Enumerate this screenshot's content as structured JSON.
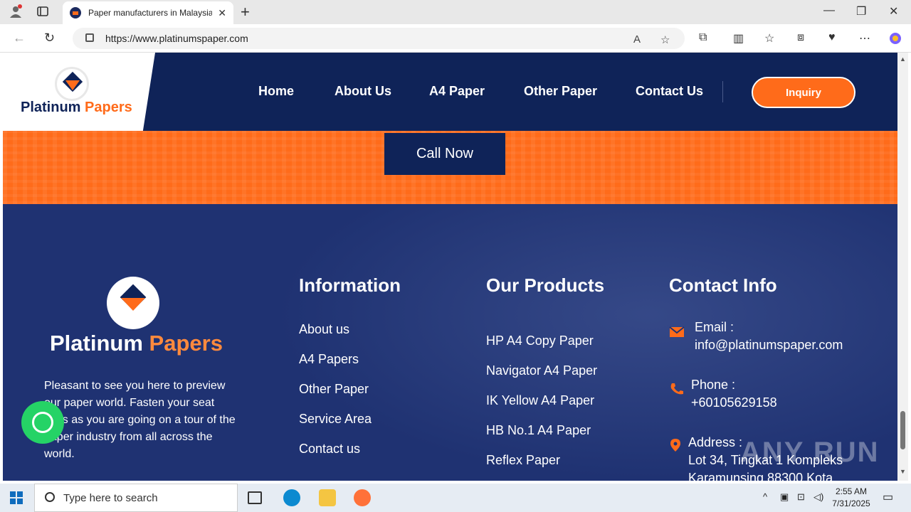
{
  "browser": {
    "tab_title": "Paper manufacturers in Malaysia, ",
    "url": "https://www.platinumspaper.com"
  },
  "site": {
    "logo_name_1": "Platinum",
    "logo_name_2": "Papers",
    "nav": [
      "Home",
      "About Us",
      "A4 Paper",
      "Other Paper",
      "Contact Us"
    ],
    "inquiry_label": "Inquiry",
    "call_now_label": "Call Now"
  },
  "footer": {
    "brand_1": "Platinum",
    "brand_2": "Papers",
    "about_text": "Pleasant to see you here to preview our paper world. Fasten your seat belts as you are going on a tour of the paper industry from all across the world.",
    "information": {
      "title": "Information",
      "links": [
        "About us",
        "A4 Papers",
        "Other Paper",
        "Service Area",
        "Contact us"
      ]
    },
    "products": {
      "title": "Our Products",
      "links": [
        "HP A4 Copy Paper",
        "Navigator A4 Paper",
        "IK Yellow A4 Paper",
        "HB No.1 A4 Paper",
        "Reflex Paper"
      ]
    },
    "contact": {
      "title": "Contact Info",
      "email_label": "Email :",
      "email_value": "info@platinumspaper.com",
      "phone_label": "Phone :",
      "phone_value": "+60105629158",
      "address_label": "Address :",
      "address_line1": "Lot 34, Tingkat 1 Kompleks",
      "address_line2": "Karamunsing 88300 Kota"
    }
  },
  "watermark": "ANY RUN",
  "taskbar": {
    "search_placeholder": "Type here to search",
    "time": "2:55 AM",
    "date": "7/31/2025"
  },
  "colors": {
    "navy": "#0f2358",
    "orange": "#ff6b1a",
    "footer_blue": "#1f3272",
    "whatsapp": "#25d366"
  }
}
